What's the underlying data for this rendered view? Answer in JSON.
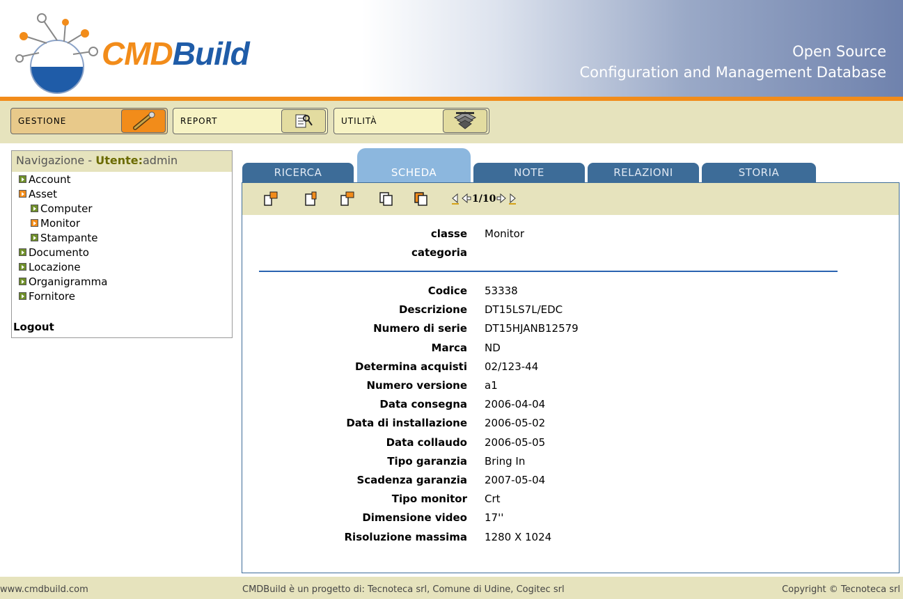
{
  "header": {
    "logo_cmd": "CMD",
    "logo_build": "Build",
    "tagline_1": "Open Source",
    "tagline_2": "Configuration and Management Database",
    "colors": {
      "orange": "#f28c1a",
      "blue": "#1f5ca8"
    }
  },
  "menu": {
    "gestione": {
      "label": "GESTIONE",
      "icon": "wrench-icon"
    },
    "report": {
      "label": "REPORT",
      "icon": "report-search-icon"
    },
    "utilita": {
      "label": "UTILITÀ",
      "icon": "tools-stack-icon"
    }
  },
  "sidebar": {
    "title": "Navigazione - ",
    "user_label": "Utente:",
    "user": "admin",
    "items": [
      {
        "label": "Account",
        "level": 0,
        "state": "collapsed"
      },
      {
        "label": "Asset",
        "level": 0,
        "state": "expanded"
      },
      {
        "label": "Computer",
        "level": 1,
        "state": "collapsed"
      },
      {
        "label": "Monitor",
        "level": 1,
        "state": "selected"
      },
      {
        "label": "Stampante",
        "level": 1,
        "state": "collapsed"
      },
      {
        "label": "Documento",
        "level": 0,
        "state": "collapsed"
      },
      {
        "label": "Locazione",
        "level": 0,
        "state": "collapsed"
      },
      {
        "label": "Organigramma",
        "level": 0,
        "state": "collapsed"
      },
      {
        "label": "Fornitore",
        "level": 0,
        "state": "collapsed"
      }
    ],
    "logout": "Logout"
  },
  "tabs": {
    "ricerca": "RICERCA",
    "scheda": "SCHEDA",
    "note": "NOTE",
    "relazioni": "RELAZIONI",
    "storia": "STORIA",
    "active": "SCHEDA"
  },
  "toolbar": {
    "icons": [
      "new-card-icon",
      "edit-card-icon",
      "new-card-alt-icon",
      "copy-card-icon",
      "clone-card-icon"
    ],
    "pager": "1/10"
  },
  "card": {
    "header_fields": [
      {
        "label": "classe",
        "value": "Monitor"
      },
      {
        "label": "categoria",
        "value": ""
      }
    ],
    "fields": [
      {
        "label": "Codice",
        "value": "53338"
      },
      {
        "label": "Descrizione",
        "value": "DT15LS7L/EDC"
      },
      {
        "label": "Numero di serie",
        "value": "DT15HJANB12579"
      },
      {
        "label": "Marca",
        "value": "ND"
      },
      {
        "label": "Determina acquisti",
        "value": "02/123-44"
      },
      {
        "label": "Numero versione",
        "value": "a1"
      },
      {
        "label": "Data consegna",
        "value": "2006-04-04"
      },
      {
        "label": "Data di installazione",
        "value": "2006-05-02"
      },
      {
        "label": "Data collaudo",
        "value": "2006-05-05"
      },
      {
        "label": "Tipo garanzia",
        "value": "Bring In"
      },
      {
        "label": "Scadenza garanzia",
        "value": "2007-05-04"
      },
      {
        "label": "Tipo monitor",
        "value": "Crt"
      },
      {
        "label": "Dimensione video",
        "value": "17''"
      },
      {
        "label": "Risoluzione massima",
        "value": "1280 X 1024"
      }
    ]
  },
  "footer": {
    "left": "www.cmdbuild.com",
    "center": "CMDBuild è un progetto di: Tecnoteca srl, Comune di Udine, Cogitec srl",
    "right": "Copyright © Tecnoteca srl"
  }
}
